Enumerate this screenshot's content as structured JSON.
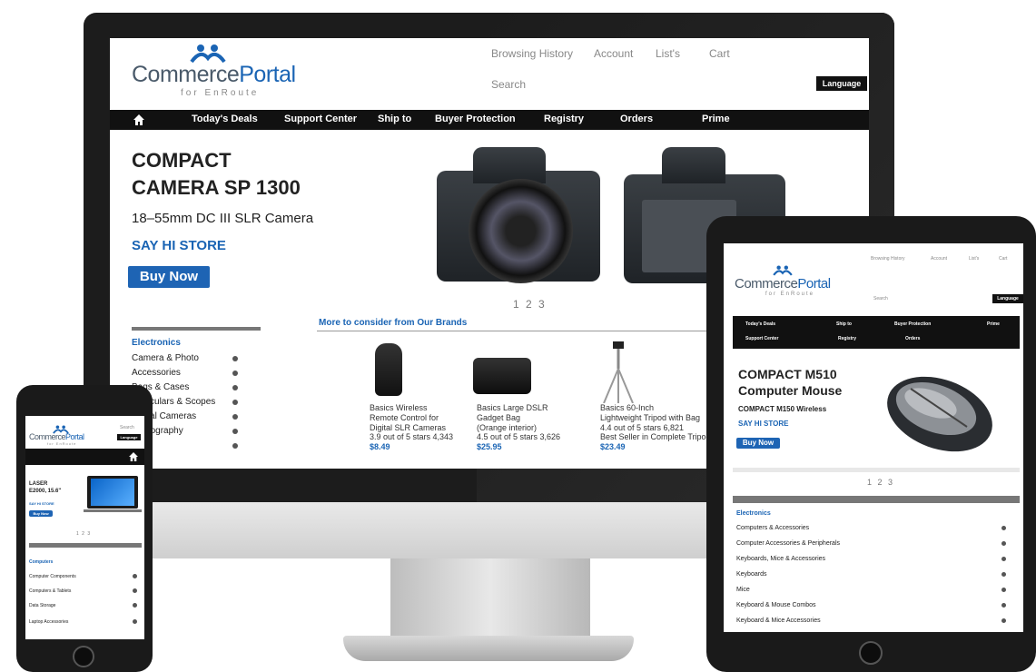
{
  "brand": {
    "logo_left": "Commerce",
    "logo_right": "Portal",
    "logo_sub": "for EnRoute"
  },
  "colors": {
    "accent": "#1a64b4",
    "nav_bg": "#111111",
    "device": "#1c1c1c"
  },
  "desktop": {
    "top_links": [
      "Browsing History",
      "Account",
      "List's",
      "Cart"
    ],
    "search_label": "Search",
    "language_button": "Language",
    "nav": {
      "home_icon": "home-icon",
      "items": [
        "Today's Deals",
        "Support Center",
        "Ship to",
        "Buyer Protection",
        "Registry",
        "Orders",
        "Prime"
      ]
    },
    "hero": {
      "title_line1": "COMPACT",
      "title_line2": "CAMERA SP 1300",
      "subtitle": "18–55mm DC III SLR Camera",
      "store": "SAY HI STORE",
      "buy_button": "Buy Now",
      "pager": "1 2 3"
    },
    "categories": {
      "heading": "Electronics",
      "items": [
        "Camera & Photo",
        "Accessories",
        "Bags & Cases",
        "Binoculars & Scopes",
        "Digital Cameras",
        "Photography"
      ]
    },
    "brands": {
      "heading": "More to consider from Our Brands",
      "products": [
        {
          "line1": "Basics Wireless",
          "line2": "Remote Control for",
          "line3": "Digital SLR Cameras",
          "rating": "3.9 out of 5 stars 4,343",
          "price": "$8.49"
        },
        {
          "line1": "Basics Large DSLR",
          "line2": "Gadget Bag",
          "line3": "(Orange interior)",
          "rating": "4.5 out of 5 stars 3,626",
          "price": "$25.95"
        },
        {
          "line1": "Basics 60-Inch",
          "line2": "Lightweight Tripod with Bag",
          "line3": "4.4 out of 5 stars 6,821",
          "rating": "Best Seller in Complete Tripods",
          "price": "$23.49"
        }
      ]
    }
  },
  "tablet": {
    "top_links": [
      "Browsing History",
      "Account",
      "List's",
      "Cart"
    ],
    "search_label": "Search",
    "language_button": "Language",
    "nav_row1": [
      "Today's Deals",
      "Ship to",
      "Buyer Protection",
      "Prime"
    ],
    "nav_row2": [
      "Support Center",
      "Registry",
      "Orders"
    ],
    "hero": {
      "title_line1": "COMPACT M510",
      "title_line2": "Computer Mouse",
      "subtitle": "COMPACT M150 Wireless",
      "store": "SAY HI STORE",
      "buy_button": "Buy Now",
      "pager": "1 2 3"
    },
    "categories": {
      "heading": "Electronics",
      "items": [
        "Computers & Accessories",
        "Computer Accessories & Peripherals",
        "Keyboards, Mice & Accessories",
        "Keyboards",
        "Mice",
        "Keyboard & Mouse Combos",
        "Keyboard & Mice Accessories"
      ]
    }
  },
  "phone": {
    "search_label": "Search",
    "language_button": "Language",
    "hero": {
      "title_line1": "LASER",
      "title_line2": "E2000, 15.6\"",
      "subtitle": "SAY HI STORE",
      "buy_button": "Buy Now",
      "pager": "1 2 3"
    },
    "categories": {
      "heading": "Computers",
      "items": [
        "Computer Components",
        "Computers & Tablets",
        "Data Storage",
        "Laptop Accessories"
      ]
    }
  }
}
